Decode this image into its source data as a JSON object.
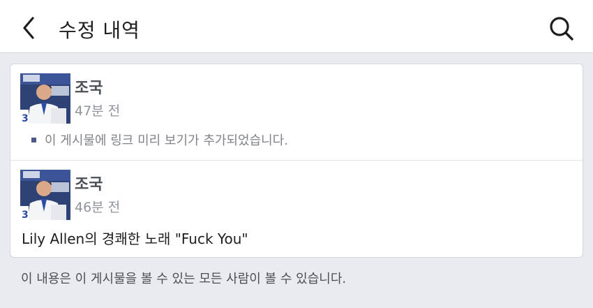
{
  "header": {
    "title": "수정 내역",
    "back_icon": "chevron-left-icon",
    "search_icon": "search-icon"
  },
  "entries": [
    {
      "author": "조국",
      "time": "47분 전",
      "note": "이 게시물에 링크 미리 보기가 추가되었습니다."
    },
    {
      "author": "조국",
      "time": "46분 전",
      "text": "Lily Allen의 경쾌한 노래 \"Fuck You\""
    }
  ],
  "footer": {
    "visibility_note": "이 내용은 이 게시물을 볼 수 있는 모든 사람이 볼 수 있습니다."
  },
  "colors": {
    "background": "#e9ebee",
    "card": "#ffffff",
    "author": "#4b4f56",
    "meta": "#90949c"
  }
}
